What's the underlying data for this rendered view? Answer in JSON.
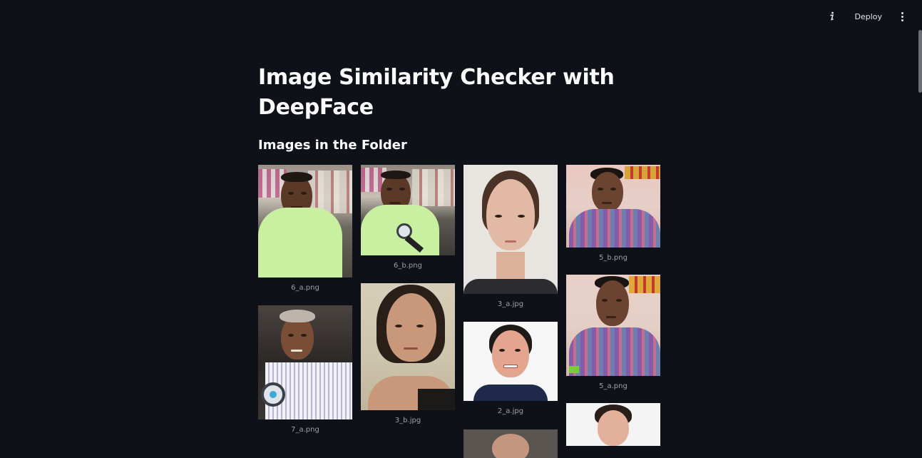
{
  "header": {
    "info_icon": "info-icon",
    "deploy_label": "Deploy",
    "menu_icon": "kebab-menu-icon"
  },
  "page": {
    "title": "Image Similarity Checker with DeepFace",
    "section_heading": "Images in the Folder"
  },
  "images": [
    {
      "caption": "6_a.png"
    },
    {
      "caption": "6_b.png"
    },
    {
      "caption": "3_a.jpg"
    },
    {
      "caption": "5_b.png"
    },
    {
      "caption": "7_a.png"
    },
    {
      "caption": "3_b.jpg"
    },
    {
      "caption": "2_a.jpg"
    },
    {
      "caption": "5_a.png"
    }
  ]
}
